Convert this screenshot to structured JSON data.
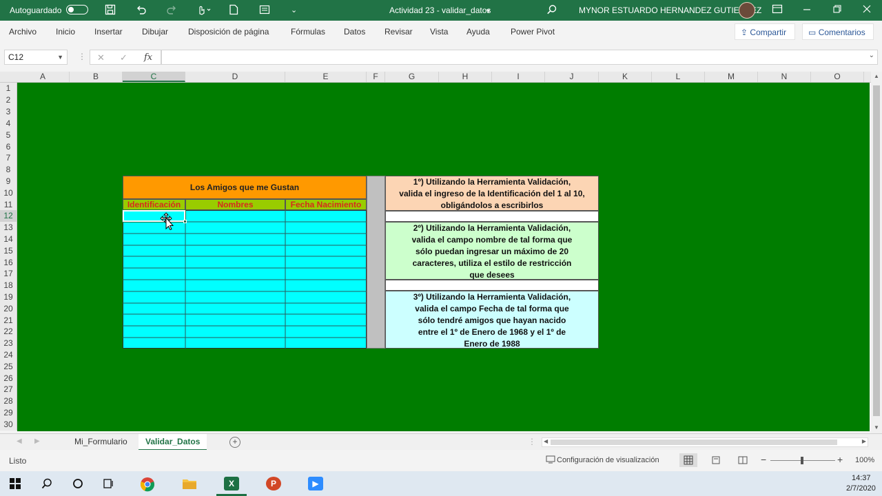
{
  "titlebar": {
    "autosave_label": "Autoguardado",
    "doc_title": "Actividad 23 - validar_datos",
    "user_name": "MYNOR ESTUARDO HERNANDEZ GUTIERREZ"
  },
  "menu": {
    "items": [
      "Archivo",
      "Inicio",
      "Insertar",
      "Dibujar",
      "Disposición de página",
      "Fórmulas",
      "Datos",
      "Revisar",
      "Vista",
      "Ayuda",
      "Power Pivot"
    ],
    "share_label": "Compartir",
    "comments_label": "Comentarios"
  },
  "formula_bar": {
    "name_box": "C12",
    "fx_label": "fx",
    "formula": ""
  },
  "columns": [
    "A",
    "B",
    "C",
    "D",
    "E",
    "F",
    "G",
    "H",
    "I",
    "J",
    "K",
    "L",
    "M",
    "N",
    "O"
  ],
  "rows": [
    "1",
    "2",
    "3",
    "4",
    "5",
    "6",
    "7",
    "8",
    "9",
    "10",
    "11",
    "12",
    "13",
    "14",
    "15",
    "16",
    "17",
    "18",
    "19",
    "20",
    "21",
    "22",
    "23",
    "24",
    "25",
    "26",
    "27",
    "28",
    "29",
    "30"
  ],
  "selected_cell": {
    "column": "C",
    "row": "12"
  },
  "table": {
    "title": "Los Amigos que me Gustan",
    "headers": [
      "Identificación",
      "Nombres",
      "Fecha Nacimiento"
    ]
  },
  "notes": [
    {
      "text": "1º) Utilizando la Herramienta Validación,\nvalida el ingreso de la Identificación del 1 al 10,\nobligándolos a escribirlos",
      "color": "#fcd5b4"
    },
    {
      "text": "2º) Utilizando la Herramienta Validación,\nvalida el campo nombre de tal forma que\nsólo puedan ingresar un máximo de 20\ncaracteres, utiliza el estilo de restricción\nque desees",
      "color": "#ccffcc"
    },
    {
      "text": "3º) Utilizando la Herramienta Validación,\nvalida el campo Fecha de tal forma que\nsólo tendré amigos que hayan nacido\nentre el 1º de Enero de 1968 y el 1º de\nEnero de 1988",
      "color": "#ccffff"
    }
  ],
  "sheet_tabs": [
    "Mi_Formulario",
    "Validar_Datos"
  ],
  "active_tab": "Validar_Datos",
  "status": {
    "ready": "Listo",
    "display_settings": "Configuración de visualización",
    "zoom": "100%"
  },
  "taskbar": {
    "time": "14:37",
    "date": "2/7/2020"
  },
  "colors": {
    "excel_green": "#217346",
    "sheet_fill": "#007d00",
    "title_fill": "#ff9900",
    "header_fill": "#99cc00",
    "header_text": "#d52b1e",
    "data_fill": "#00ffff"
  }
}
